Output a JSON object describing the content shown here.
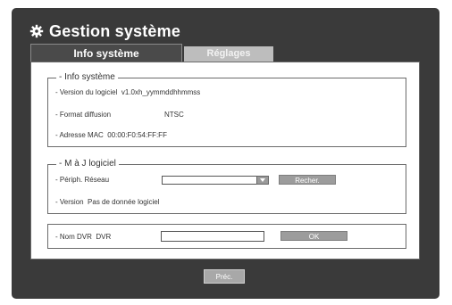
{
  "header": {
    "title": "Gestion système",
    "icon": "gear-icon"
  },
  "tabs": [
    {
      "label": "Info système",
      "active": true
    },
    {
      "label": "Réglages",
      "active": false
    }
  ],
  "info_systeme": {
    "legend": "Info système",
    "version_label": "Version du logiciel",
    "version_value": "v1.0xh_yymmddhhmmss",
    "format_label": "Format diffusion",
    "format_value": "NTSC",
    "mac_label": "Adresse MAC",
    "mac_value": "00:00:F0:54:FF:FF"
  },
  "maj": {
    "legend": "M à J logiciel",
    "periph_label": "Périph. Réseau",
    "periph_value": "",
    "search_button": "Recher.",
    "version_label": "Version",
    "version_value": "Pas de donnée logiciel"
  },
  "dvr": {
    "name_label": "Nom DVR",
    "name_prefix": "DVR",
    "name_value": "",
    "ok_button": "OK"
  },
  "footer": {
    "prev_button": "Préc."
  },
  "colors": {
    "frame": "#3a3a3a",
    "button": "#9c9c9c",
    "panel": "#ffffff"
  }
}
